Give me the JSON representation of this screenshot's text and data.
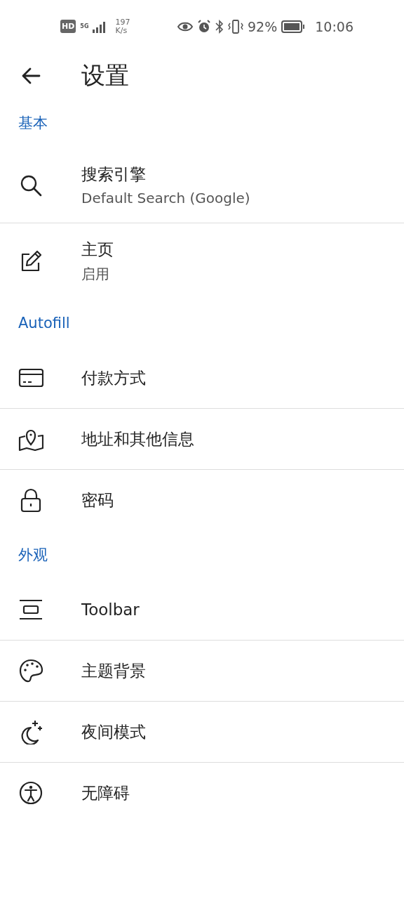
{
  "status_bar": {
    "hd_badge": "HD",
    "network_type": "5G",
    "speed_value": "197",
    "speed_unit": "K/s",
    "battery": "92%",
    "time": "10:06"
  },
  "header": {
    "title": "设置"
  },
  "sections": [
    {
      "title": "基本",
      "items": [
        {
          "title": "搜索引擎",
          "subtitle": "Default Search (Google)"
        },
        {
          "title": "主页",
          "subtitle": "启用"
        }
      ]
    },
    {
      "title": "Autofill",
      "items": [
        {
          "title": "付款方式"
        },
        {
          "title": "地址和其他信息"
        },
        {
          "title": "密码"
        }
      ]
    },
    {
      "title": "外观",
      "items": [
        {
          "title": "Toolbar"
        },
        {
          "title": "主题背景"
        },
        {
          "title": "夜间模式"
        },
        {
          "title": "无障碍"
        }
      ]
    }
  ]
}
